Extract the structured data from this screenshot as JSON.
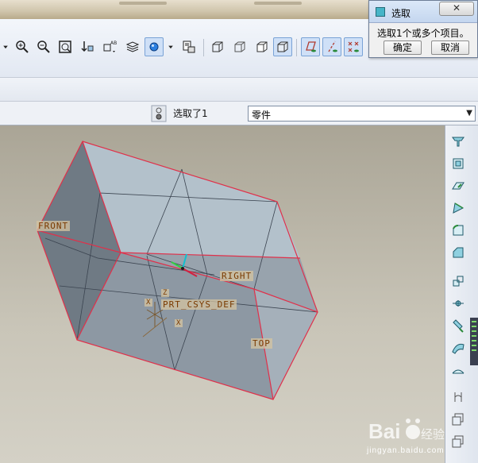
{
  "dialog": {
    "title": "选取",
    "message": "选取1个或多个项目。",
    "ok_label": "确定",
    "cancel_label": "取消"
  },
  "status": {
    "selection_text": "选取了1",
    "filter_value": "零件"
  },
  "model_labels": {
    "front": "FRONT",
    "right": "RIGHT",
    "top": "TOP",
    "csys": "PRT_CSYS_DEF",
    "axis_z": "Z",
    "axis_x": "X",
    "axis_x2": "X"
  },
  "watermark": {
    "text": "jingyan.baidu.com"
  },
  "toolbar": {
    "icons": [
      "dropdown-arrow-icon",
      "zoom-in-icon",
      "zoom-out-icon",
      "refit-icon",
      "reorient-icon",
      "saved-views-icon",
      "layers-icon",
      "appearance-icon",
      "model-tree-icon",
      "wireframe-icon",
      "hidden-line-icon",
      "no-hidden-icon",
      "shading-icon",
      "datum-planes-icon",
      "datum-axes-icon",
      "datum-points-icon"
    ]
  },
  "right_toolbar": {
    "icons": [
      "extrude-icon",
      "hole-icon",
      "shell-icon",
      "rib-icon",
      "round-icon",
      "chamfer-icon",
      "mirror-icon",
      "pattern-icon",
      "trim-icon",
      "sweep-icon",
      "surface-icon",
      "datum-plane-icon",
      "csys-icon",
      "sketch-icon"
    ]
  },
  "colors": {
    "edge_highlight": "#e0304a",
    "face": "#a9b4be",
    "face_dark": "#6f7a84",
    "background": "#c7c2b4"
  }
}
